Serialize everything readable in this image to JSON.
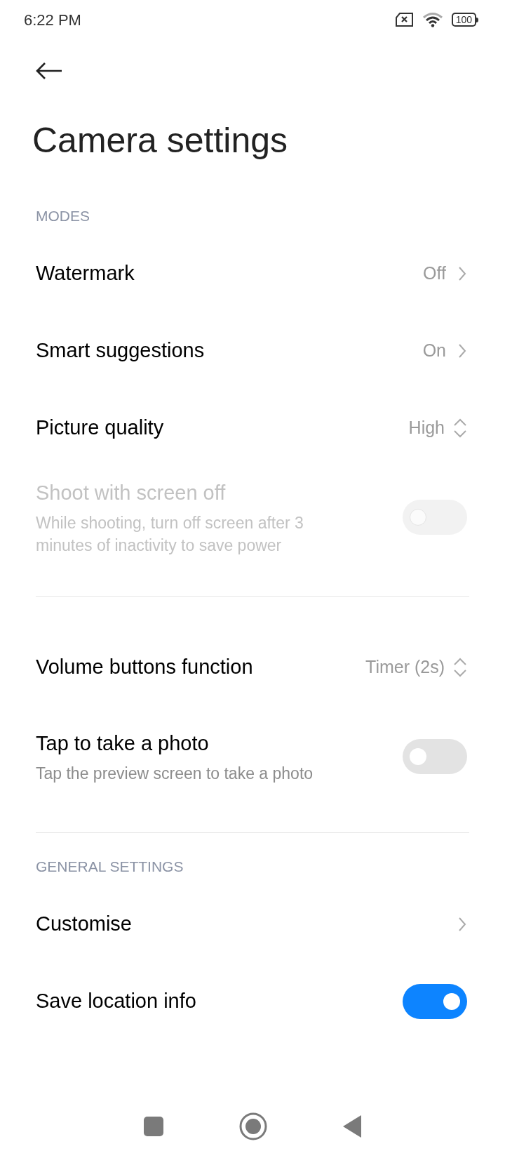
{
  "status_bar": {
    "time": "6:22 PM",
    "battery": "100"
  },
  "title": "Camera settings",
  "sections": [
    {
      "header": "MODES",
      "groups": [
        [
          {
            "kind": "link",
            "label": "Watermark",
            "value": "Off"
          },
          {
            "kind": "link",
            "label": "Smart suggestions",
            "value": "On"
          },
          {
            "kind": "select",
            "label": "Picture quality",
            "value": "High"
          },
          {
            "kind": "toggle",
            "label": "Shoot with screen off",
            "description": "While shooting, turn off screen after 3 minutes of inactivity to save power",
            "on": false,
            "disabled": true
          }
        ],
        [
          {
            "kind": "select",
            "label": "Volume buttons function",
            "value": "Timer (2s)"
          },
          {
            "kind": "toggle",
            "label": "Tap to take a photo",
            "description": "Tap the preview screen to take a photo",
            "on": false,
            "disabled": false
          }
        ]
      ]
    },
    {
      "header": "GENERAL SETTINGS",
      "groups": [
        [
          {
            "kind": "link",
            "label": "Customise"
          },
          {
            "kind": "toggle",
            "label": "Save location info",
            "on": true,
            "disabled": false
          }
        ]
      ]
    }
  ]
}
